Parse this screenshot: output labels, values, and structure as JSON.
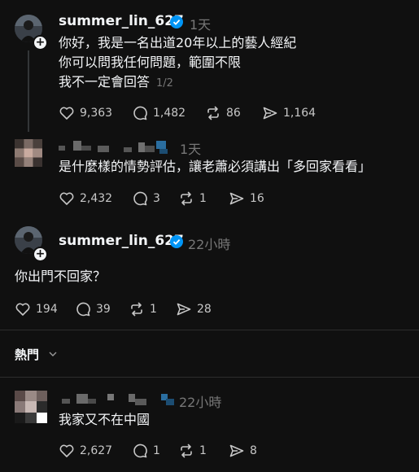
{
  "posts": [
    {
      "username": "summer_lin_627",
      "time": "1天",
      "lines": [
        "你好，我是一名出道20年以上的藝人經紀",
        "你可以問我任何問題，範圍不限",
        "我不一定會回答"
      ],
      "page_indicator": "1/2",
      "likes": "9,363",
      "comments": "1,482",
      "reposts": "86",
      "shares": "1,164"
    },
    {
      "username": "",
      "time": "1天",
      "lines": [
        "是什麼樣的情勢評估，讓老蕭必須講出「多回家看看」"
      ],
      "likes": "2,432",
      "comments": "3",
      "reposts": "1",
      "shares": "16"
    },
    {
      "username": "summer_lin_627",
      "time": "22小時",
      "lines": [
        "你出門不回家？"
      ],
      "likes": "194",
      "comments": "39",
      "reposts": "1",
      "shares": "28"
    },
    {
      "username": "",
      "time": "22小時",
      "lines": [
        "我家又不在中國"
      ],
      "likes": "2,627",
      "comments": "1",
      "reposts": "1",
      "shares": "8"
    }
  ],
  "sort": {
    "label": "熱門"
  },
  "icons": {
    "like": "heart-icon",
    "comment": "comment-icon",
    "repost": "repost-icon",
    "share": "share-icon",
    "verified": "verified-badge-icon",
    "follow": "plus-icon"
  },
  "colors": {
    "background": "#101010",
    "text": "#f3f5f7",
    "muted": "#777777",
    "verified": "#0095f6"
  }
}
